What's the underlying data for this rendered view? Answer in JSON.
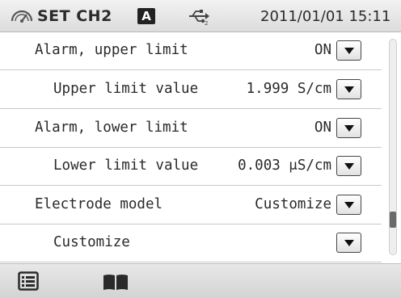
{
  "header": {
    "title": "SET CH2",
    "mode_badge": "A",
    "datetime": "2011/01/01 15:11",
    "icons": [
      "gauge-icon",
      "usb-icon"
    ]
  },
  "settings": [
    {
      "label": "Alarm, upper limit",
      "value": "ON",
      "indent": false
    },
    {
      "label": "Upper limit value",
      "value": "1.999 S/cm",
      "indent": true
    },
    {
      "label": "Alarm, lower limit",
      "value": "ON",
      "indent": false
    },
    {
      "label": "Lower limit value",
      "value": "0.003 μS/cm",
      "indent": true
    },
    {
      "label": "Electrode model",
      "value": "Customize",
      "indent": false
    },
    {
      "label": "Customize",
      "value": "",
      "indent": true
    }
  ],
  "footer": {
    "icons": [
      "list-icon",
      "book-icon"
    ]
  },
  "scroll": {
    "position_fraction": 0.82
  }
}
